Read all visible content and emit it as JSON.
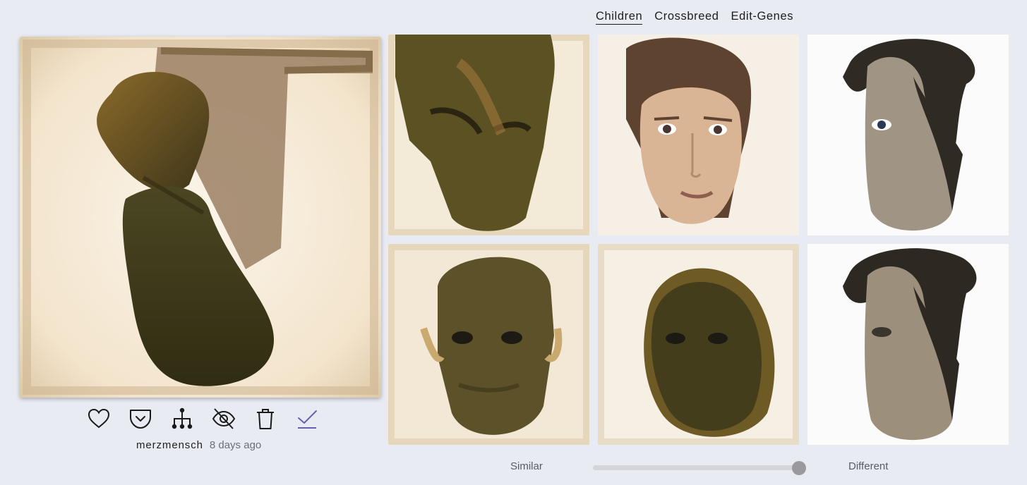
{
  "tabs": [
    {
      "label": "Children",
      "active": true
    },
    {
      "label": "Crossbreed",
      "active": false
    },
    {
      "label": "Edit-Genes",
      "active": false
    }
  ],
  "main_image": {
    "author": "merzmensch",
    "time_ago": "8 days ago"
  },
  "actions": [
    {
      "icon": "heart-icon",
      "label": "like"
    },
    {
      "icon": "pocket-icon",
      "label": "save"
    },
    {
      "icon": "family-tree-icon",
      "label": "lineage"
    },
    {
      "icon": "eye-slash-icon",
      "label": "hide"
    },
    {
      "icon": "trash-icon",
      "label": "delete"
    },
    {
      "icon": "checkmark-icon",
      "label": "select"
    }
  ],
  "children": [
    {
      "style": "dark-face"
    },
    {
      "style": "woman-portrait"
    },
    {
      "style": "dark-hair-face"
    },
    {
      "style": "dark-face-ears"
    },
    {
      "style": "dark-face-round"
    },
    {
      "style": "dark-hair-face-2"
    }
  ],
  "slider": {
    "left_label": "Similar",
    "right_label": "Different",
    "value": 1.0
  },
  "colors": {
    "background": "#e8ebf2",
    "check_accent": "#6a5fb4"
  }
}
